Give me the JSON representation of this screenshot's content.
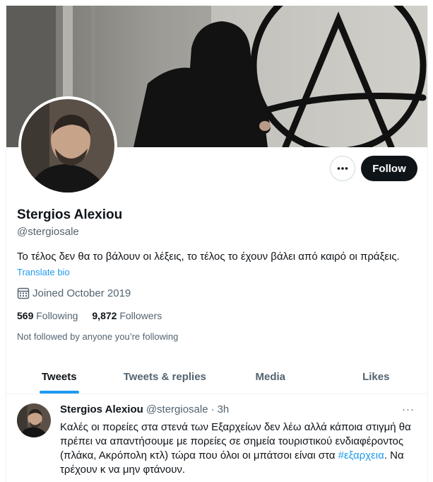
{
  "profile": {
    "name": "Stergios Alexiou",
    "handle": "@stergiosale",
    "bio": "Το τέλος δεν θα το βάλουν οι λέξεις, το τέλος το έχουν βάλει από καιρό οι πράξεις.",
    "translate_label": "Translate bio",
    "joined": "Joined October 2019",
    "following_count": "569",
    "following_label": "Following",
    "followers_count": "9,872",
    "followers_label": "Followers",
    "not_followed": "Not followed by anyone you’re following"
  },
  "actions": {
    "follow_label": "Follow",
    "more_icon": "ellipsis-icon"
  },
  "tabs": [
    {
      "label": "Tweets",
      "active": true
    },
    {
      "label": "Tweets & replies",
      "active": false
    },
    {
      "label": "Media",
      "active": false
    },
    {
      "label": "Likes",
      "active": false
    }
  ],
  "tweet": {
    "name": "Stergios Alexiou",
    "handle": "@stergiosale",
    "dot": "·",
    "time": "3h",
    "more": "···",
    "text_before": "Καλές οι πορείες στα στενά των Εξαρχείων δεν λέω αλλά κάποια στιγμή θα πρέπει να απαντήσουμε με πορείες σε σημεία τουριστικού ενδιαφέροντος (πλάκα, Ακρόπολη κτλ) τώρα που όλοι οι μπάτσοι είναι στα ",
    "hashtag": "#εξαρχεια",
    "text_after": ". Να τρέχουν κ να μην φτάνουν."
  },
  "colors": {
    "accent": "#1d9bf0",
    "text_primary": "#0f1419",
    "text_secondary": "#536471",
    "border": "#eff3f4"
  }
}
